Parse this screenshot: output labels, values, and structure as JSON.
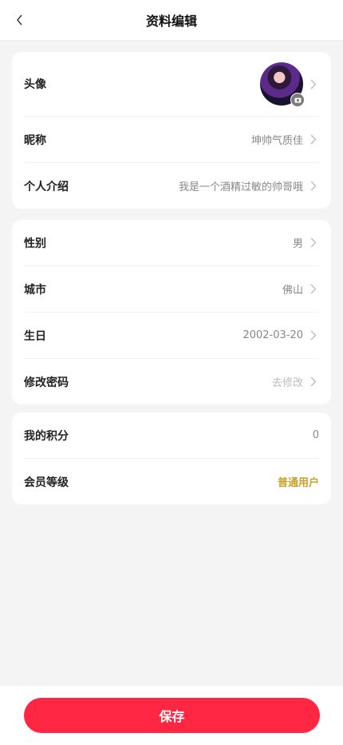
{
  "header": {
    "title": "资料编辑",
    "back_icon": "chevron-left-icon"
  },
  "profile_card": {
    "avatar_label": "头像",
    "nickname_label": "昵称",
    "nickname_value": "坤帅气质佳",
    "intro_label": "个人介绍",
    "intro_value": "我是一个酒精过敏的帅哥哦"
  },
  "info_card": {
    "gender_label": "性别",
    "gender_value": "男",
    "city_label": "城市",
    "city_value": "佛山",
    "birthday_label": "生日",
    "birthday_value": "2002-03-20",
    "password_label": "修改密码",
    "password_value": "去修改"
  },
  "member_card": {
    "points_label": "我的积分",
    "points_value": "0",
    "level_label": "会员等级",
    "level_value": "普通用户"
  },
  "footer": {
    "save_label": "保存"
  },
  "colors": {
    "accent": "#ff2742",
    "gold": "#c9a227",
    "background": "#f4f4f4"
  }
}
